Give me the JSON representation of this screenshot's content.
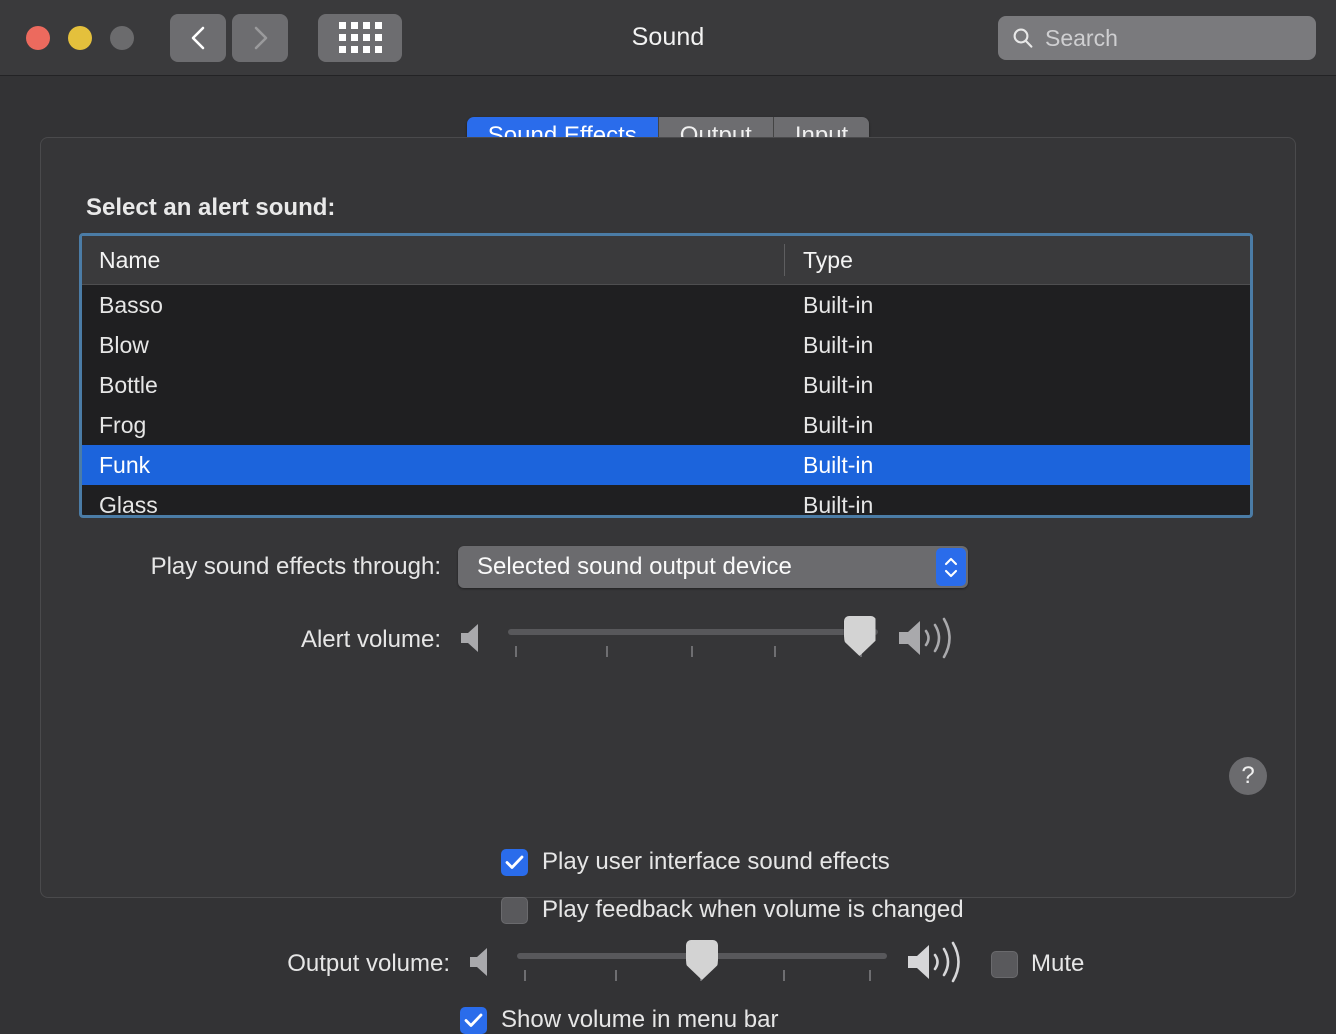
{
  "window": {
    "title": "Sound",
    "traffic_lights": [
      "close",
      "minimize",
      "zoom"
    ],
    "nav": {
      "back": "back-arrow",
      "forward": "forward-arrow",
      "grid": "show-all-grid"
    },
    "search": {
      "placeholder": "Search",
      "value": ""
    }
  },
  "tabs": [
    {
      "label": "Sound Effects",
      "active": true
    },
    {
      "label": "Output",
      "active": false
    },
    {
      "label": "Input",
      "active": false
    }
  ],
  "panel": {
    "label": "Select an alert sound:",
    "table": {
      "columns": [
        "Name",
        "Type"
      ],
      "rows": [
        {
          "name": "Basso",
          "type": "Built-in",
          "selected": false
        },
        {
          "name": "Blow",
          "type": "Built-in",
          "selected": false
        },
        {
          "name": "Bottle",
          "type": "Built-in",
          "selected": false
        },
        {
          "name": "Frog",
          "type": "Built-in",
          "selected": false
        },
        {
          "name": "Funk",
          "type": "Built-in",
          "selected": true
        },
        {
          "name": "Glass",
          "type": "Built-in",
          "selected": false
        }
      ]
    },
    "output_device": {
      "label": "Play sound effects through:",
      "value": "Selected sound output device"
    },
    "alert_volume": {
      "label": "Alert volume:",
      "value": 95,
      "min": 0,
      "max": 100,
      "ticks": 5
    },
    "checkboxes": [
      {
        "label": "Play user interface sound effects",
        "checked": true
      },
      {
        "label": "Play feedback when volume is changed",
        "checked": false
      }
    ],
    "help": "?"
  },
  "footer": {
    "output_volume": {
      "label": "Output volume:",
      "value": 50,
      "min": 0,
      "max": 100,
      "ticks": 5
    },
    "mute": {
      "label": "Mute",
      "checked": false
    },
    "show_in_menu_bar": {
      "label": "Show volume in menu bar",
      "checked": true
    }
  },
  "colors": {
    "accent": "#2a6ceb",
    "selection": "#1c64dc",
    "window_bg": "#333335",
    "titlebar_bg": "#3a3a3c",
    "table_bg": "#1f1f21",
    "table_header_bg": "#3a3a3c",
    "focus_ring": "#4b7ca6"
  }
}
